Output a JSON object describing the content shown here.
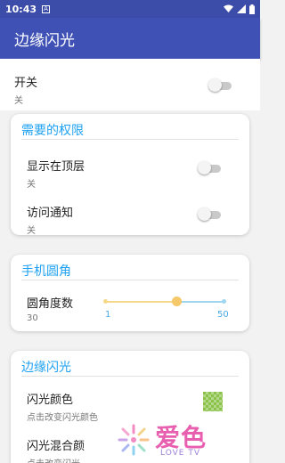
{
  "status_bar": {
    "time": "10:43",
    "notif_letter": "A"
  },
  "app_bar": {
    "title": "边缘闪光"
  },
  "master_switch": {
    "title": "开关",
    "summary": "关",
    "state": false
  },
  "permissions_card": {
    "title": "需要的权限",
    "items": [
      {
        "title": "显示在顶层",
        "summary": "关",
        "state": false
      },
      {
        "title": "访问通知",
        "summary": "关",
        "state": false
      }
    ]
  },
  "corner_card": {
    "title": "手机圆角",
    "slider": {
      "title": "圆角度数",
      "value": "30",
      "min_label": "1",
      "max_label": "50",
      "fraction": 0.6
    }
  },
  "flash_card": {
    "title": "边缘闪光",
    "items": [
      {
        "title": "闪光颜色",
        "summary": "点击改变闪光颜色"
      },
      {
        "title": "闪光混合颜",
        "summary": "点击改变闪光"
      }
    ],
    "swatch_color": "#8bc34a"
  },
  "watermark": {
    "text": "爱色",
    "sub": "LOVE TV"
  },
  "colors": {
    "primary": "#3f51b5",
    "primary_dark": "#3b4ca9",
    "accent": "#1ea1f2",
    "slider_active": "#f5d98a",
    "slider_inactive": "#9ed6f0"
  }
}
